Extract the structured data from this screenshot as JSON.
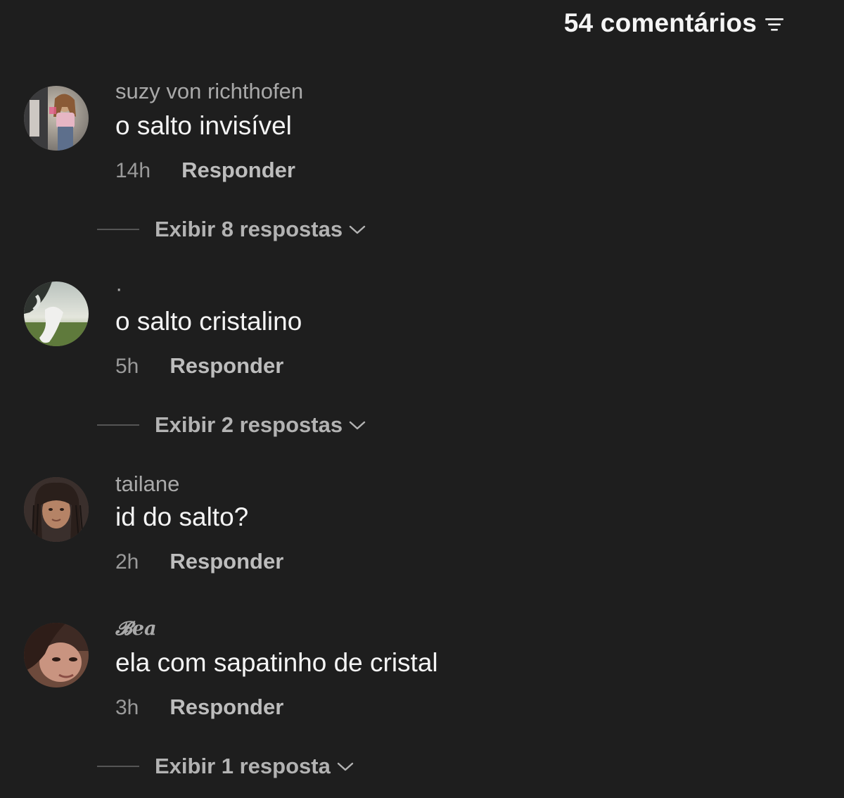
{
  "header": {
    "comment_count": "54 comentários",
    "filter_icon": "filter-lines-icon"
  },
  "comments": [
    {
      "username": "suzy von richthofen",
      "text": "o salto invisível",
      "time": "14h",
      "reply_label": "Responder",
      "replies_label": "Exibir 8 respostas",
      "avatar_icon": "user-avatar-photo"
    },
    {
      "username": "·",
      "text": "o salto cristalino",
      "time": "5h",
      "reply_label": "Responder",
      "replies_label": "Exibir 2 respostas",
      "avatar_icon": "user-avatar-photo"
    },
    {
      "username": "tailane",
      "text": "id do salto?",
      "time": "2h",
      "reply_label": "Responder",
      "replies_label": "",
      "avatar_icon": "user-avatar-photo"
    },
    {
      "username": "𝓑ea",
      "text": "ela com sapatinho de cristal",
      "time": "3h",
      "reply_label": "Responder",
      "replies_label": "Exibir 1 resposta",
      "avatar_icon": "user-avatar-photo"
    }
  ]
}
